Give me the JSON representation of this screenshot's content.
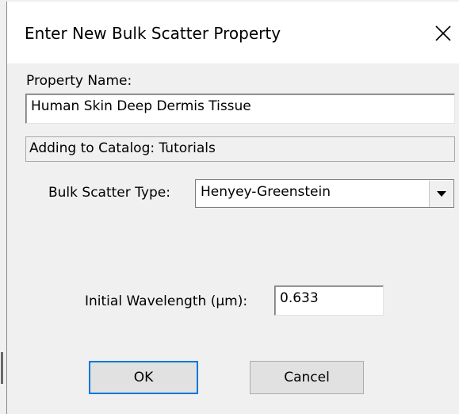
{
  "dialog": {
    "background_title_fragment": "",
    "title": "Enter New Bulk Scatter Property",
    "close_symbol": "✕"
  },
  "form": {
    "property_name_label": "Property Name:",
    "property_name_value": "Human Skin Deep Dermis Tissue",
    "catalog_text": "Adding to Catalog: Tutorials",
    "scatter_type_label": "Bulk Scatter Type:",
    "scatter_type_value": "Henyey-Greenstein",
    "wavelength_label": "Initial Wavelength (µm):",
    "wavelength_value": "0.633"
  },
  "buttons": {
    "ok_label": "OK",
    "cancel_label": "Cancel"
  },
  "colors": {
    "window_bg": "#f0f0f0",
    "titlebar_bg": "#ffffff",
    "button_bg": "#e1e1e1",
    "default_button_border": "#0078d7"
  }
}
